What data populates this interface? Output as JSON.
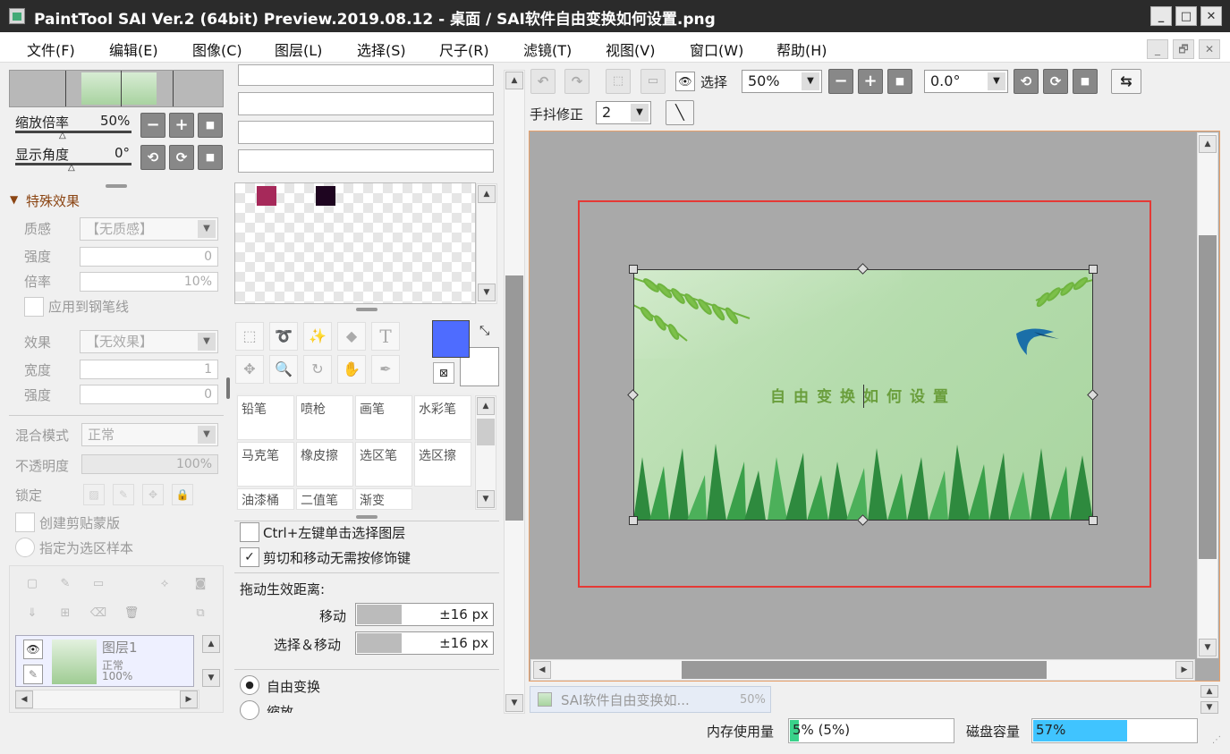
{
  "titlebar": {
    "title": "PaintTool SAI Ver.2 (64bit) Preview.2019.08.12 - 桌面 / SAI软件自由变换如何设置.png",
    "min": "_",
    "max": "□",
    "close": "✕"
  },
  "menu": [
    "文件(F)",
    "编辑(E)",
    "图像(C)",
    "图层(L)",
    "选择(S)",
    "尺子(R)",
    "滤镜(T)",
    "视图(V)",
    "窗口(W)",
    "帮助(H)"
  ],
  "mdi": {
    "min": "_",
    "restore": "🗗",
    "close": "✕"
  },
  "navigator": {
    "zoom_label": "缩放倍率",
    "zoom_value": "50%",
    "angle_label": "显示角度",
    "angle_value": "0°"
  },
  "effects": {
    "header": "特殊效果",
    "texture_label": "质感",
    "texture_value": "【无质感】",
    "strength_label": "强度",
    "strength_value": "0",
    "scale_label": "倍率",
    "scale_value": "10%",
    "apply_pen": "应用到钢笔线",
    "effect_label": "效果",
    "effect_value": "【无效果】",
    "width_label": "宽度",
    "width_value": "1",
    "strength2_label": "强度",
    "strength2_value": "0"
  },
  "layer_props": {
    "blend_label": "混合模式",
    "blend_value": "正常",
    "opacity_label": "不透明度",
    "opacity_value": "100%",
    "lock_label": "锁定",
    "clip_label": "创建剪贴蒙版",
    "sample_label": "指定为选区样本"
  },
  "layer": {
    "name": "图层1",
    "mode": "正常",
    "opacity": "100%"
  },
  "colors": {
    "swatch1": "#a6295a",
    "swatch2": "#1e0520",
    "primary": "#4e6cff",
    "secondary": "#ffffff",
    "accent": "#e53935"
  },
  "brushes": [
    [
      "铅笔",
      "喷枪",
      "画笔",
      "水彩笔"
    ],
    [
      "马克笔",
      "橡皮擦",
      "选区笔",
      "选区擦"
    ],
    [
      "油漆桶",
      "二值笔",
      "渐变",
      ""
    ]
  ],
  "tool_opts": {
    "opt1": "Ctrl+左键单击选择图层",
    "opt2": "剪切和移动无需按修饰键",
    "drag_title": "拖动生效距离:",
    "move_label": "移动",
    "move_value": "±16 px",
    "select_label": "选择＆移动",
    "select_value": "±16 px",
    "mode1": "自由变换",
    "mode2": "缩放"
  },
  "toolbar": {
    "select_label": "选择",
    "zoom_value": "50%",
    "angle_value": "0.0°",
    "stab_label": "手抖修正",
    "stab_value": "2"
  },
  "canvas": {
    "image_text": "自由变换如何设置"
  },
  "doc_tab": {
    "name": "SAI软件自由变换如...",
    "zoom": "50%"
  },
  "status": {
    "mem_label": "内存使用量",
    "mem_value": "5% (5%)",
    "mem_fraction": 0.05,
    "disk_label": "磁盘容量",
    "disk_value": "57%",
    "disk_fraction": 0.57
  }
}
